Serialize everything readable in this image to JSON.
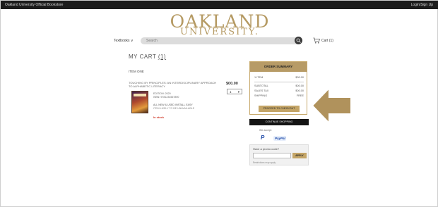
{
  "topbar": {
    "left": "Oakland University Official Bookstore",
    "right": "Login/Sign Up"
  },
  "logo": {
    "line1": "OAKLAND",
    "line2": "UNIVERSITY."
  },
  "header": {
    "category": "Textbooks ∨",
    "search_placeholder": "Search",
    "cart_label": "Cart (1)"
  },
  "cart": {
    "title": "MY CART",
    "count": "(1)",
    "item_heading": "ITEM ONE",
    "item_title": "TOUCHING BY PRINCIPLES: AN INTERDISCIPLINARY APPROACH TO ALPHABETIC LITERACY",
    "price": "$00.00",
    "qty": "1",
    "meta": [
      "EDITION: 2020",
      "ISBN: 9781234567890",
      "ALL NEW & USED INSTALL EASY",
      "ITEM LIKELY TO BE UNAVAILABLE"
    ],
    "stock_status": "In stock"
  },
  "summary": {
    "header": "ORDER SUMMARY",
    "rows": [
      {
        "label": "1 ITEM",
        "value": "$00.00"
      },
      {
        "label": "SUBTOTAL",
        "value": "$00.00"
      },
      {
        "label": "SALES TAX",
        "value": "$00.00"
      },
      {
        "label": "SHIPPING",
        "value": "FREE"
      }
    ],
    "proceed": "PROCEED TO CHECKOUT",
    "continue": "CONTINUE SHOPPING",
    "accept": "We accept:",
    "paypal": "P",
    "paypal_text": "PayPal"
  },
  "promo": {
    "question": "Have a promo code?",
    "apply": "APPLY",
    "note": "Restrictions may apply"
  },
  "colors": {
    "gold": "#b59a63",
    "arrow": "#b0925c",
    "dark": "#141414"
  }
}
